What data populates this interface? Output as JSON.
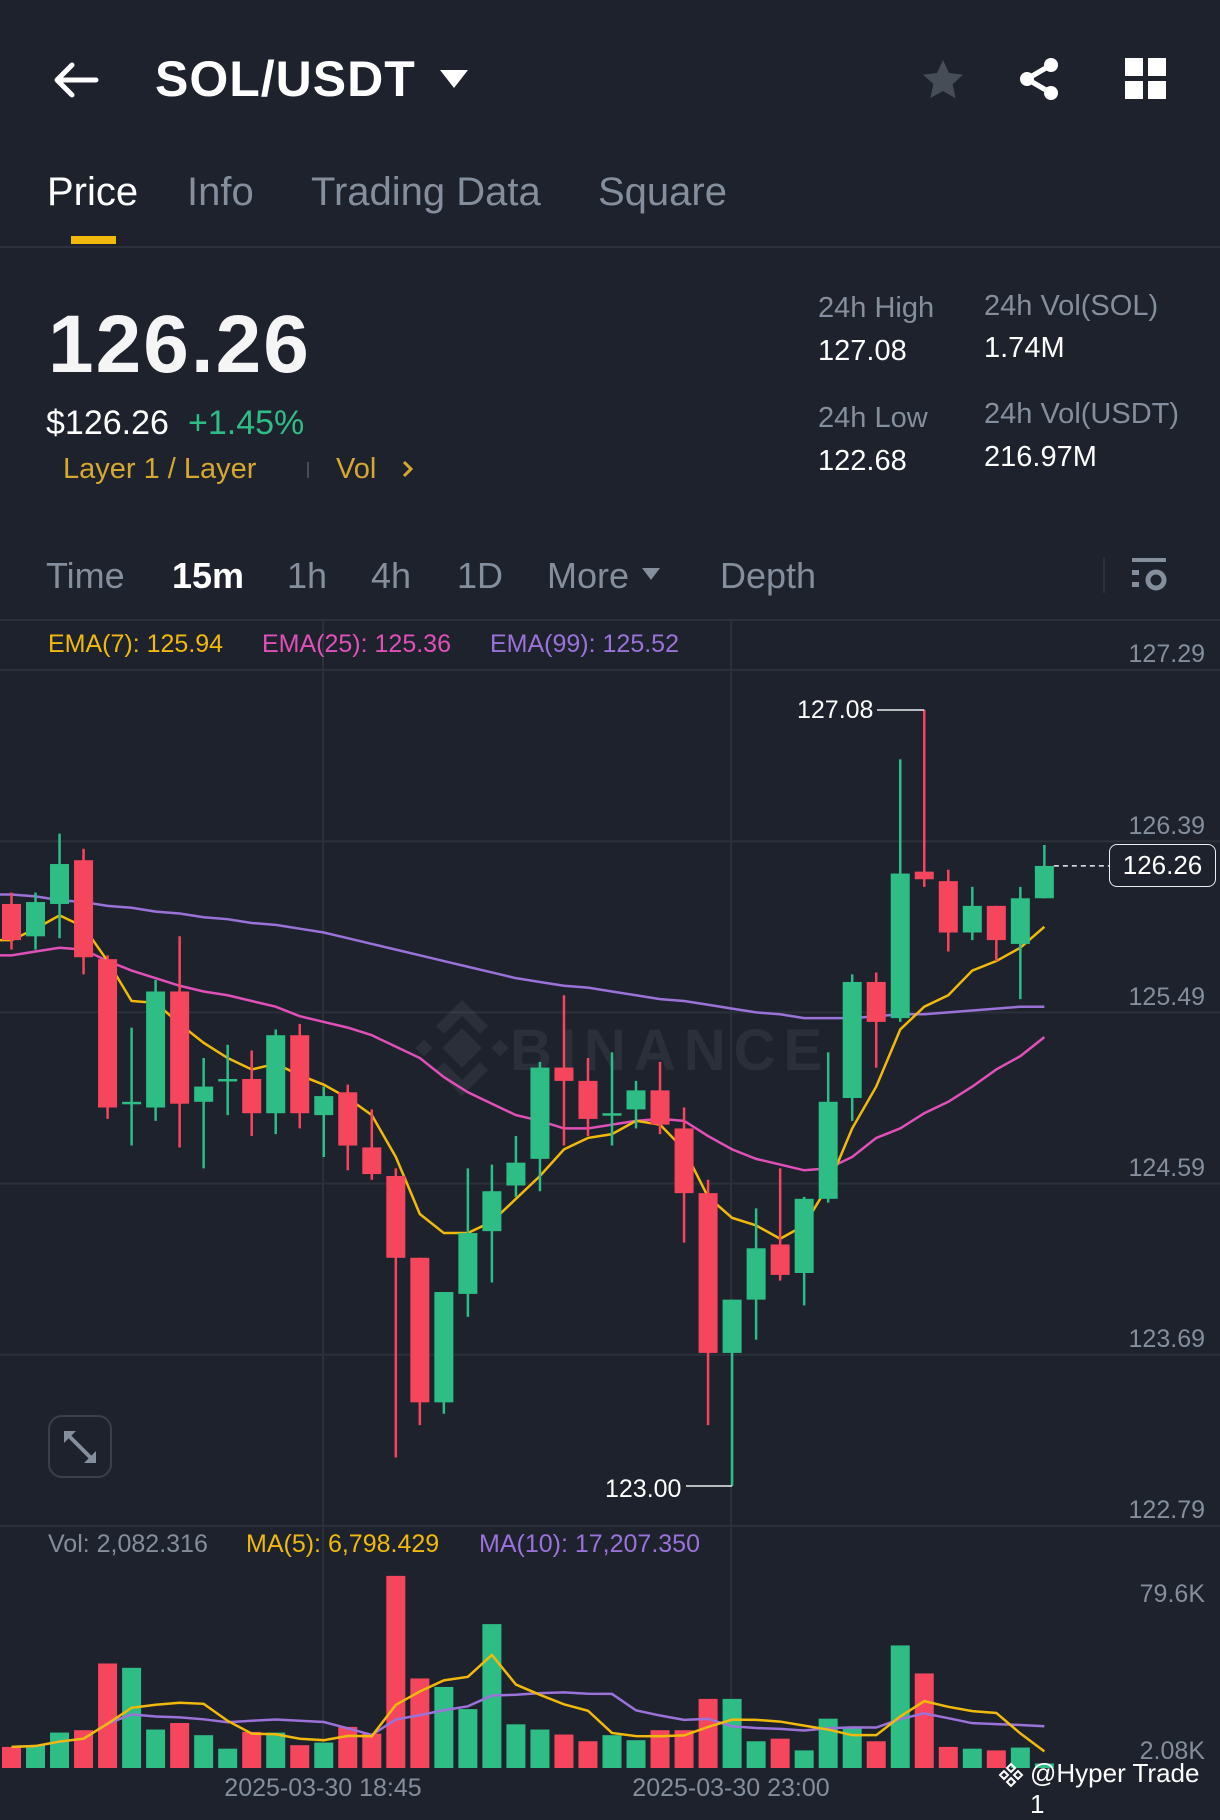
{
  "header": {
    "pair": "SOL/USDT",
    "icons": [
      "back-arrow-icon",
      "dropdown-icon",
      "star-icon",
      "share-icon",
      "grid-icon"
    ]
  },
  "tabs": [
    {
      "label": "Price",
      "active": true
    },
    {
      "label": "Info"
    },
    {
      "label": "Trading Data"
    },
    {
      "label": "Square"
    }
  ],
  "ticker": {
    "price": "126.26",
    "usd_price": "$126.26",
    "change": "+1.45%",
    "tag": "Layer 1 / Layer",
    "vol_link": "Vol",
    "high_label": "24h High",
    "high": "127.08",
    "low_label": "24h Low",
    "low": "122.68",
    "vol_sol_label": "24h Vol(SOL)",
    "vol_sol": "1.74M",
    "vol_usdt_label": "24h Vol(USDT)",
    "vol_usdt": "216.97M"
  },
  "timeframes": {
    "items": [
      "Time",
      "15m",
      "1h",
      "4h",
      "1D",
      "More",
      "Depth"
    ],
    "active": "15m"
  },
  "colors": {
    "up": "#2ebd85",
    "down": "#f6465d",
    "ema7": "#f0b90b",
    "ema25": "#e050b8",
    "ema99": "#9b72d9",
    "accent": "#f0b90b"
  },
  "legend": {
    "ema7": "EMA(7): 125.94",
    "ema25": "EMA(25): 125.36",
    "ema99": "EMA(99): 125.52"
  },
  "vol_legend": {
    "vol": "Vol: 2,082.316",
    "ma5": "MA(5): 6,798.429",
    "ma10": "MA(10): 17,207.350"
  },
  "annotations": {
    "high": "127.08",
    "low": "123.00",
    "current": "126.26"
  },
  "x_labels": [
    "2025-03-30 18:45",
    "2025-03-30 23:00"
  ],
  "watermark": {
    "logo_text": "BINANCE",
    "credit": "@Hyper Trade 1"
  },
  "chart_data": {
    "type": "candlestick",
    "interval": "15m",
    "price_axis": {
      "ticks": [
        "127.29",
        "126.39",
        "125.49",
        "124.59",
        "123.69",
        "122.79"
      ],
      "ylim": [
        122.79,
        127.29
      ]
    },
    "volume_axis": {
      "ticks": [
        "79.6K",
        "2.08K"
      ],
      "unit": "K"
    },
    "ohlc": [
      [
        126.06,
        125.87,
        126.12,
        125.82
      ],
      [
        125.89,
        126.07,
        126.12,
        125.82
      ],
      [
        126.06,
        126.27,
        126.43,
        125.88
      ],
      [
        126.29,
        125.78,
        126.35,
        125.69
      ],
      [
        125.77,
        124.99,
        125.79,
        124.93
      ],
      [
        125.01,
        125.02,
        125.41,
        124.79
      ],
      [
        124.99,
        125.6,
        125.66,
        124.92
      ],
      [
        125.6,
        125.01,
        125.89,
        124.78
      ],
      [
        125.02,
        125.1,
        125.25,
        124.67
      ],
      [
        125.13,
        125.14,
        125.32,
        124.95
      ],
      [
        125.14,
        124.96,
        125.29,
        124.84
      ],
      [
        124.96,
        125.37,
        125.4,
        124.85
      ],
      [
        125.37,
        124.96,
        125.43,
        124.88
      ],
      [
        124.95,
        125.05,
        125.1,
        124.73
      ],
      [
        125.07,
        124.79,
        125.11,
        124.66
      ],
      [
        124.78,
        124.64,
        124.98,
        124.61
      ],
      [
        124.63,
        124.2,
        124.67,
        123.15
      ],
      [
        124.2,
        123.44,
        124.2,
        123.32
      ],
      [
        123.44,
        124.02,
        124.02,
        123.38
      ],
      [
        124.01,
        124.33,
        124.67,
        123.89
      ],
      [
        124.34,
        124.55,
        124.69,
        124.07
      ],
      [
        124.58,
        124.7,
        124.84,
        124.52
      ],
      [
        124.72,
        125.2,
        125.23,
        124.55
      ],
      [
        125.2,
        125.13,
        125.58,
        124.79
      ],
      [
        125.13,
        124.93,
        125.25,
        124.84
      ],
      [
        124.95,
        124.96,
        125.28,
        124.79
      ],
      [
        124.98,
        125.08,
        125.13,
        124.88
      ],
      [
        125.08,
        124.9,
        125.23,
        124.85
      ],
      [
        124.88,
        124.54,
        124.99,
        124.28
      ],
      [
        124.54,
        123.7,
        124.61,
        123.32
      ],
      [
        123.7,
        123.98,
        123.98,
        123.0
      ],
      [
        123.98,
        124.25,
        124.46,
        123.77
      ],
      [
        124.27,
        124.11,
        124.67,
        124.08
      ],
      [
        124.12,
        124.51,
        124.52,
        123.95
      ],
      [
        124.51,
        125.02,
        125.28,
        124.49
      ],
      [
        125.04,
        125.65,
        125.69,
        124.92
      ],
      [
        125.65,
        125.44,
        125.7,
        125.2
      ],
      [
        125.46,
        126.22,
        126.82,
        125.44
      ],
      [
        126.23,
        126.19,
        127.08,
        126.15
      ],
      [
        126.18,
        125.91,
        126.24,
        125.81
      ],
      [
        125.91,
        126.05,
        126.15,
        125.87
      ],
      [
        126.05,
        125.87,
        126.05,
        125.76
      ],
      [
        125.85,
        126.09,
        126.15,
        125.56
      ],
      [
        126.09,
        126.26,
        126.37,
        126.09
      ]
    ],
    "ema7": [
      125.87,
      125.93,
      126.0,
      125.94,
      125.76,
      125.55,
      125.54,
      125.43,
      125.33,
      125.25,
      125.19,
      125.22,
      125.16,
      125.11,
      125.04,
      124.95,
      124.73,
      124.43,
      124.33,
      124.33,
      124.39,
      124.51,
      124.63,
      124.77,
      124.83,
      124.85,
      124.92,
      124.9,
      124.77,
      124.52,
      124.41,
      124.37,
      124.3,
      124.37,
      124.58,
      124.88,
      125.1,
      125.4,
      125.52,
      125.58,
      125.71,
      125.76,
      125.83,
      125.94
    ],
    "ema25": [
      125.79,
      125.81,
      125.83,
      125.82,
      125.76,
      125.71,
      125.67,
      125.63,
      125.6,
      125.58,
      125.55,
      125.52,
      125.47,
      125.44,
      125.41,
      125.37,
      125.31,
      125.25,
      125.15,
      125.07,
      125.01,
      124.95,
      124.92,
      124.88,
      124.88,
      124.9,
      124.92,
      124.93,
      124.92,
      124.84,
      124.77,
      124.72,
      124.69,
      124.66,
      124.67,
      124.73,
      124.83,
      124.88,
      124.96,
      125.02,
      125.1,
      125.19,
      125.26,
      125.36
    ],
    "ema99": [
      126.11,
      126.1,
      126.08,
      126.07,
      126.05,
      126.04,
      126.02,
      126.01,
      125.99,
      125.98,
      125.96,
      125.95,
      125.93,
      125.91,
      125.88,
      125.85,
      125.82,
      125.79,
      125.76,
      125.73,
      125.7,
      125.67,
      125.65,
      125.63,
      125.62,
      125.6,
      125.58,
      125.56,
      125.55,
      125.53,
      125.51,
      125.49,
      125.48,
      125.46,
      125.46,
      125.46,
      125.47,
      125.48,
      125.48,
      125.49,
      125.5,
      125.51,
      125.52,
      125.52
    ],
    "volume_k": [
      9.7,
      10.5,
      16.3,
      17.4,
      48.1,
      46.1,
      17.7,
      20.7,
      15.1,
      8.9,
      16.6,
      16.3,
      10.5,
      11.7,
      18.9,
      15.8,
      88.4,
      41.2,
      37.3,
      27.1,
      66.2,
      20.1,
      17.7,
      15.4,
      12.3,
      15.1,
      12.8,
      17.4,
      17.4,
      31.8,
      31.8,
      12.3,
      13.5,
      8.1,
      22.7,
      18.9,
      12.3,
      56.4,
      43.5,
      9.7,
      8.9,
      8.1,
      9.4,
      2.08
    ]
  }
}
